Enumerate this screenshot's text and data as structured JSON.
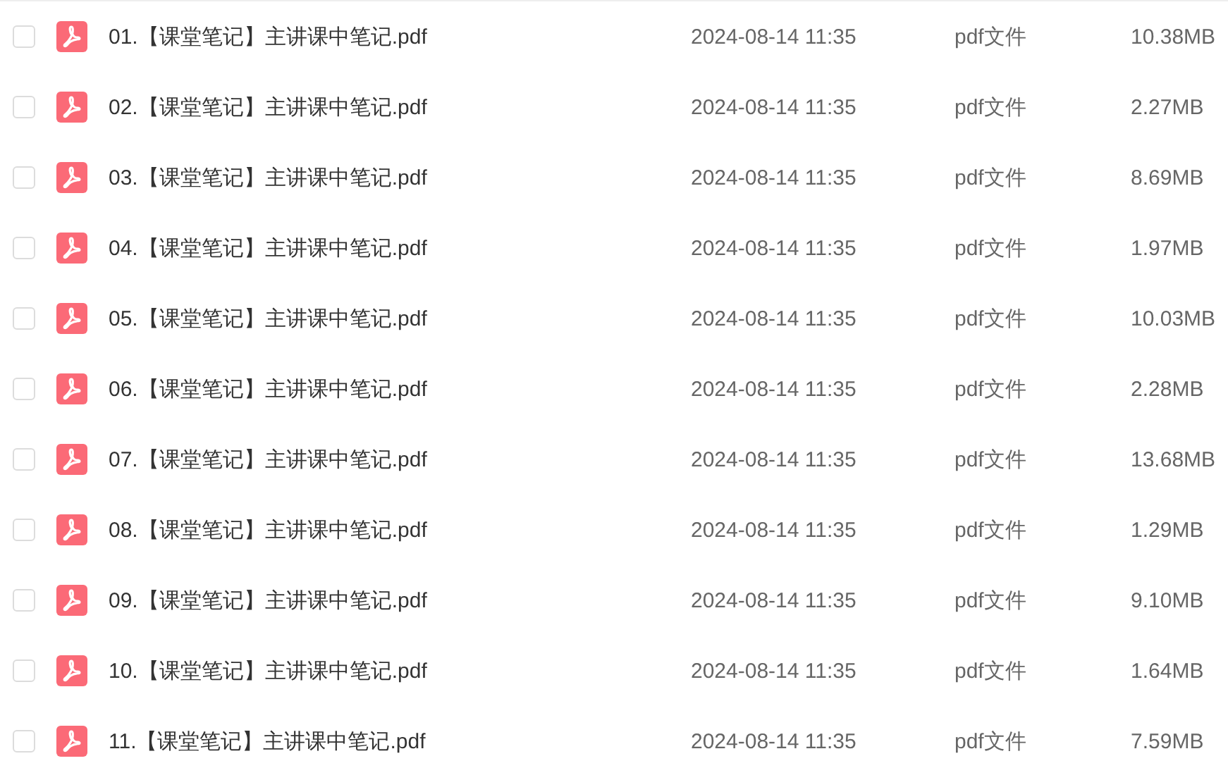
{
  "files": [
    {
      "checked": false,
      "name": "01.【课堂笔记】主讲课中笔记.pdf",
      "modified": "2024-08-14 11:35",
      "type": "pdf文件",
      "size": "10.38MB"
    },
    {
      "checked": false,
      "name": "02.【课堂笔记】主讲课中笔记.pdf",
      "modified": "2024-08-14 11:35",
      "type": "pdf文件",
      "size": "2.27MB"
    },
    {
      "checked": false,
      "name": "03.【课堂笔记】主讲课中笔记.pdf",
      "modified": "2024-08-14 11:35",
      "type": "pdf文件",
      "size": "8.69MB"
    },
    {
      "checked": false,
      "name": "04.【课堂笔记】主讲课中笔记.pdf",
      "modified": "2024-08-14 11:35",
      "type": "pdf文件",
      "size": "1.97MB"
    },
    {
      "checked": false,
      "name": "05.【课堂笔记】主讲课中笔记.pdf",
      "modified": "2024-08-14 11:35",
      "type": "pdf文件",
      "size": "10.03MB"
    },
    {
      "checked": false,
      "name": "06.【课堂笔记】主讲课中笔记.pdf",
      "modified": "2024-08-14 11:35",
      "type": "pdf文件",
      "size": "2.28MB"
    },
    {
      "checked": false,
      "name": "07.【课堂笔记】主讲课中笔记.pdf",
      "modified": "2024-08-14 11:35",
      "type": "pdf文件",
      "size": "13.68MB"
    },
    {
      "checked": false,
      "name": "08.【课堂笔记】主讲课中笔记.pdf",
      "modified": "2024-08-14 11:35",
      "type": "pdf文件",
      "size": "1.29MB"
    },
    {
      "checked": false,
      "name": "09.【课堂笔记】主讲课中笔记.pdf",
      "modified": "2024-08-14 11:35",
      "type": "pdf文件",
      "size": "9.10MB"
    },
    {
      "checked": false,
      "name": "10.【课堂笔记】主讲课中笔记.pdf",
      "modified": "2024-08-14 11:35",
      "type": "pdf文件",
      "size": "1.64MB"
    },
    {
      "checked": false,
      "name": "11.【课堂笔记】主讲课中笔记.pdf",
      "modified": "2024-08-14 11:35",
      "type": "pdf文件",
      "size": "7.59MB"
    }
  ]
}
